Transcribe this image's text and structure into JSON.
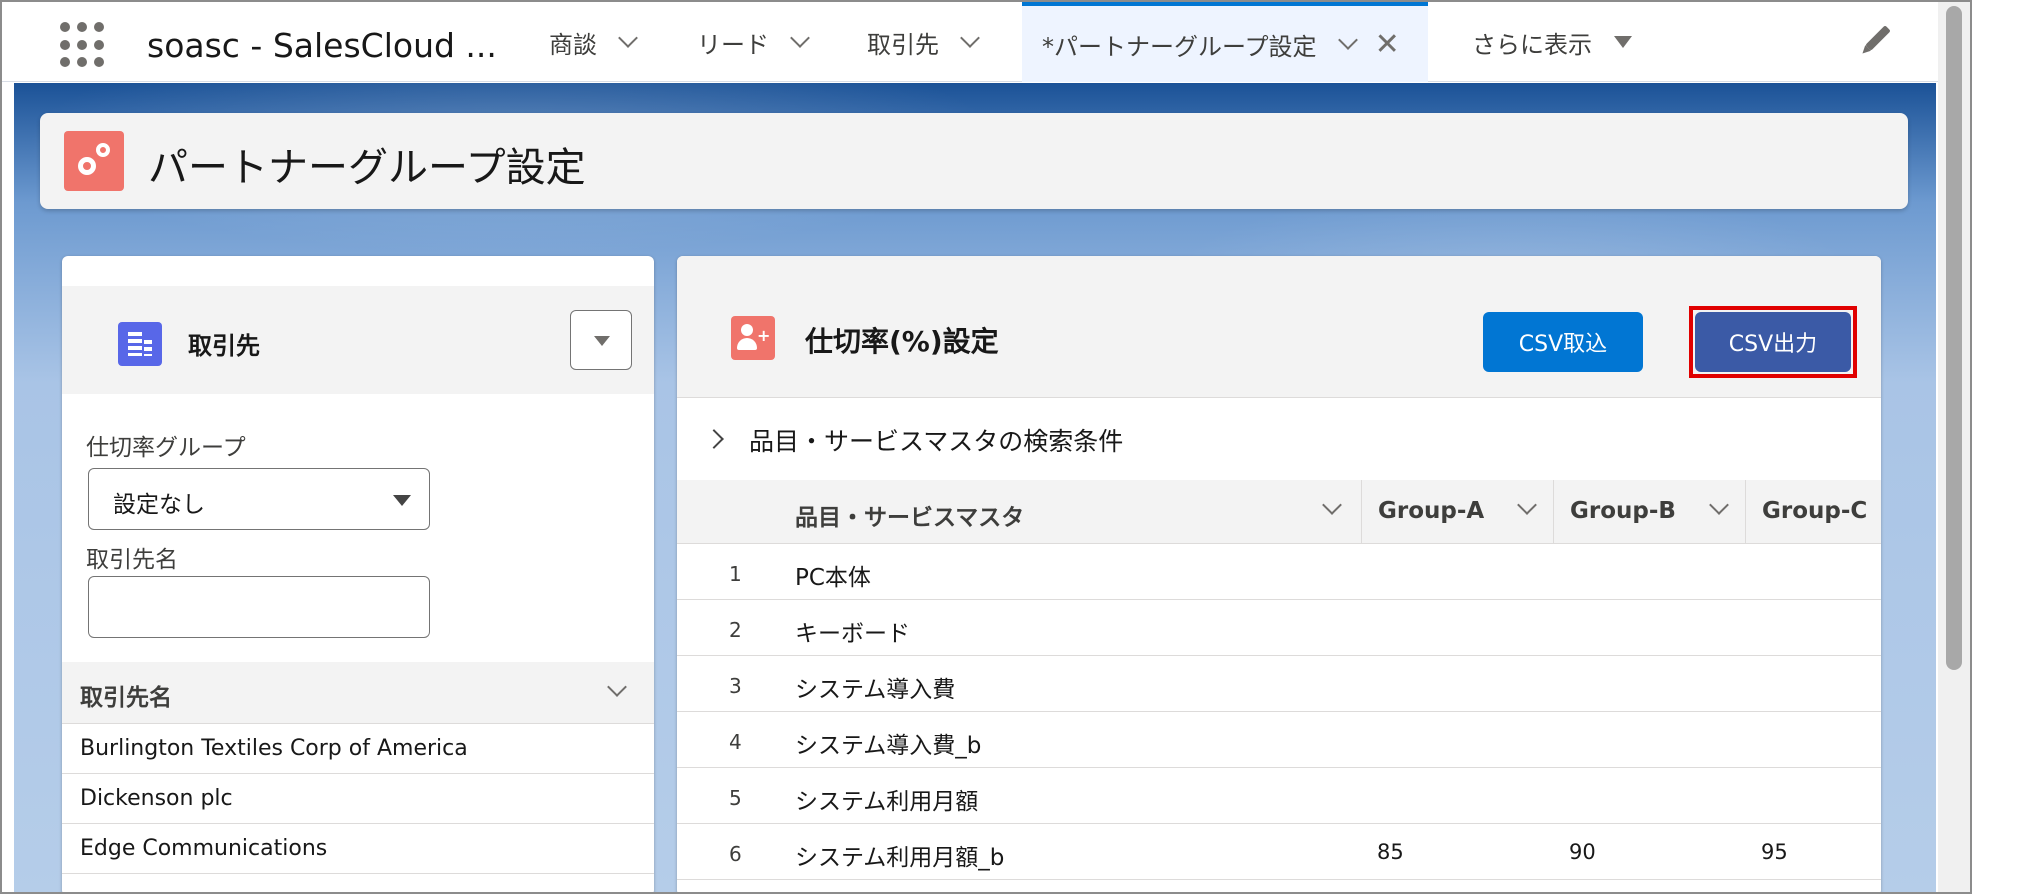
{
  "app_name": "soasc - SalesCloud ...",
  "tabs": [
    {
      "label": "商談"
    },
    {
      "label": "リード"
    },
    {
      "label": "取引先"
    },
    {
      "label": "*パートナーグループ設定",
      "active": true
    },
    {
      "label": "さらに表示"
    }
  ],
  "page_title": "パートナーグループ設定",
  "left_panel": {
    "title": "取引先",
    "rate_group_label": "仕切率グループ",
    "rate_group_value": "設定なし",
    "account_name_label": "取引先名",
    "account_name_value": "",
    "list_header": "取引先名",
    "accounts": [
      "Burlington Textiles Corp of America",
      "Dickenson plc",
      "Edge Communications"
    ]
  },
  "right_panel": {
    "title": "仕切率(%)設定",
    "import_button": "CSV取込",
    "export_button": "CSV出力",
    "search_section": "品目・サービスマスタの検索条件",
    "columns": [
      "品目・サービスマスタ",
      "Group-A",
      "Group-B",
      "Group-C"
    ],
    "rows": [
      {
        "num": "1",
        "name": "PC本体",
        "a": "",
        "b": "",
        "c": ""
      },
      {
        "num": "2",
        "name": "キーボード",
        "a": "",
        "b": "",
        "c": ""
      },
      {
        "num": "3",
        "name": "システム導入費",
        "a": "",
        "b": "",
        "c": ""
      },
      {
        "num": "4",
        "name": "システム導入費_b",
        "a": "",
        "b": "",
        "c": ""
      },
      {
        "num": "5",
        "name": "システム利用月額",
        "a": "",
        "b": "",
        "c": ""
      },
      {
        "num": "6",
        "name": "システム利用月額_b",
        "a": "85",
        "b": "90",
        "c": "95"
      }
    ]
  },
  "colors": {
    "brand_blue": "#0176d3",
    "export_button": "#3b5aa6",
    "highlight_border": "#e00000",
    "page_icon": "#f0746b",
    "account_icon": "#5867e8"
  },
  "icons": {
    "app_launcher": "waffle-icon",
    "edit": "pencil-icon",
    "page": "settings-gear-icon",
    "account": "account-building-icon",
    "rate": "user-rate-icon"
  }
}
